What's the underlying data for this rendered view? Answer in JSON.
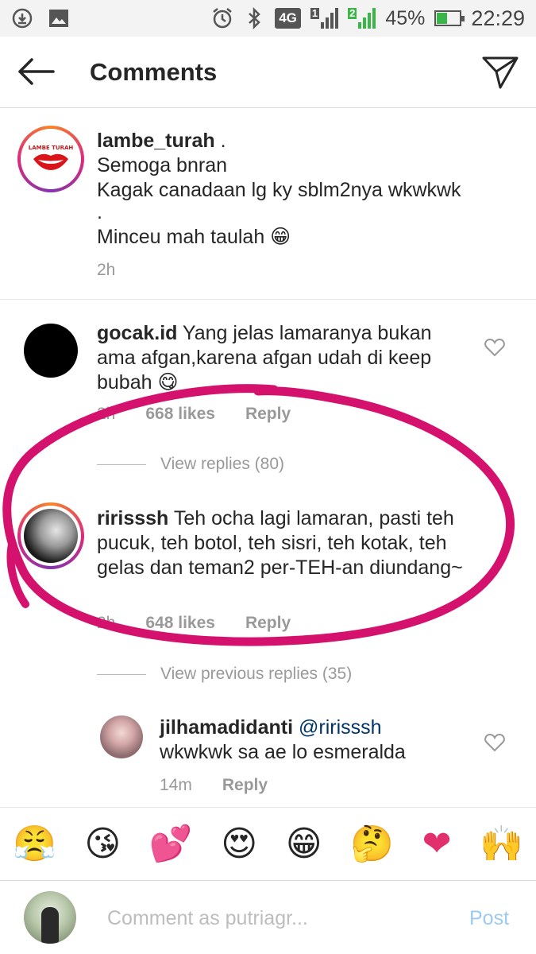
{
  "status_bar": {
    "network": "4G",
    "sim1": "1",
    "sim2": "2",
    "battery_percent": "45%",
    "battery_level": 0.45,
    "time": "22:29"
  },
  "header": {
    "title": "Comments",
    "back_icon": "arrow-left-icon",
    "send_icon": "paper-plane-icon"
  },
  "caption": {
    "username": "lambe_turah",
    "text_lines": [
      "Semoga bnran",
      "Kagak canadaan lg ky sblm2nya wkwkwk",
      ".",
      "Minceu mah taulah 😁"
    ],
    "time": "2h",
    "suffix": " ."
  },
  "comments": [
    {
      "username": "gocak.id",
      "text": "Yang jelas lamaranya bukan ama afgan,karena afgan udah di keep bubah 😋",
      "time": "2h",
      "likes": "668 likes",
      "reply": "Reply",
      "view_replies": "View replies (80)"
    },
    {
      "username": "ririsssh",
      "text": "Teh ocha lagi lamaran, pasti teh pucuk, teh botol, teh sisri, teh kotak, teh gelas dan teman2 per-TEH-an diundang~",
      "time": "2h",
      "likes": "648 likes",
      "reply": "Reply",
      "view_replies": "View previous replies (35)"
    }
  ],
  "reply": {
    "username": "jilhamadidanti",
    "mention": "@ririsssh",
    "text": "wkwkwk sa ae lo esmeralda",
    "time": "14m",
    "reply": "Reply"
  },
  "emoji_bar": [
    "😤",
    "😘",
    "💕",
    "😍",
    "😁",
    "🤔",
    "❤",
    "🙌"
  ],
  "comment_input": {
    "placeholder": "Comment as putriagr...",
    "post_label": "Post"
  },
  "colors": {
    "annotation_pink": "#d4126e",
    "post_disabled": "#9ccbf2",
    "muted": "#999999"
  }
}
